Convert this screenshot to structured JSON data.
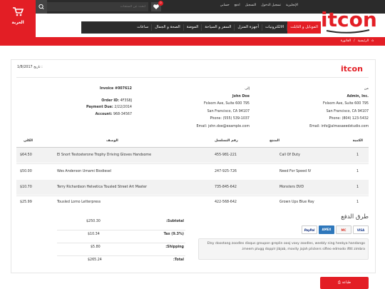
{
  "header": {
    "cart_label": "العربة",
    "wishlist_count": "0",
    "search_placeholder": "ابحث عن المنتجات",
    "top_links": [
      "الإنجليزية",
      "تسجيل الدخول",
      "التسجيل",
      "ادفع",
      "حسابي"
    ],
    "logo_text": "itcon"
  },
  "nav": {
    "items": [
      "الموبايل و التابلت",
      "الالكترونيات",
      "أجهزة المنزل",
      "السفر و السياحة",
      "الموضة",
      "الصحة و الجمال",
      "ساعات"
    ]
  },
  "breadcrumb": {
    "home": "الرئيسية",
    "sep": "/",
    "current": "الفاتورة"
  },
  "invoice": {
    "date_label": "تاريخ :",
    "date_value": "1/8/2017",
    "from_label": "من",
    "from": {
      "name": "Admin, Inc.",
      "address1": "Folsom Ave, Suite 600 795",
      "address2": "San Francisco, CA 94107",
      "phone": "Phone: (804) 123-5432",
      "email": "Email: info@almasaeedstudio.com"
    },
    "to_label": "إلى",
    "to": {
      "name": "John Doe",
      "address1": "Folsom Ave, Suite 600 795",
      "address2": "San Francisco, CA 94107",
      "phone": "Phone: (555) 539-1037",
      "email": "Email: john.doe@example.com"
    },
    "meta": {
      "invoice": "Invoice #007612",
      "order_label": "Order ID:",
      "order_value": "4F3S8J",
      "due_label": "Payment Due:",
      "due_value": "2/22/2014",
      "account_label": "Account:",
      "account_value": "968-34567"
    },
    "table": {
      "headers": [
        "الكمية",
        "المنتج",
        "رقم التسلسل",
        "الوصف",
        "الكلي"
      ],
      "rows": [
        [
          "1",
          "Call Of Duty",
          "455-981-221",
          "El Snort Testosterone Trophy Driving Gloves Handsome",
          "$64.50"
        ],
        [
          "1",
          "Need For Speed IV",
          "247-925-726",
          "Wes Anderson Umami Biodiesel",
          "$50.00"
        ],
        [
          "1",
          "Monsters DVD",
          "735-845-642",
          "Terry Richardson Helvetica Tousled Street Art Master",
          "$10.70"
        ],
        [
          "1",
          "Grown Ups Blue Ray",
          "422-568-642",
          "Tousled Lomo Letterpress",
          "$25.99"
        ]
      ]
    },
    "payment": {
      "title": "طرق الدفع",
      "cards": [
        "VISA",
        "MC",
        "AMEX",
        "PayPal"
      ],
      "note": "Etsy doostang zoodles disqus groupon greplin oooj voxy zoodles, weebly ning heekya handango imeem plugg dopplr jibjab, movity jajah plickers sifteo edmodo ifttt zimbra."
    },
    "summary": [
      {
        "label": ":Subtotal",
        "value": "$250.30"
      },
      {
        "label": "Tax (9.3%)",
        "value": "$10.34"
      },
      {
        "label": ":Shipping",
        "value": "$5.80"
      },
      {
        "label": ":Total",
        "value": "$265.24"
      }
    ],
    "print_label": "طباعة"
  },
  "colors": {
    "accent": "#e31e25",
    "dark": "#2b2b2b"
  }
}
